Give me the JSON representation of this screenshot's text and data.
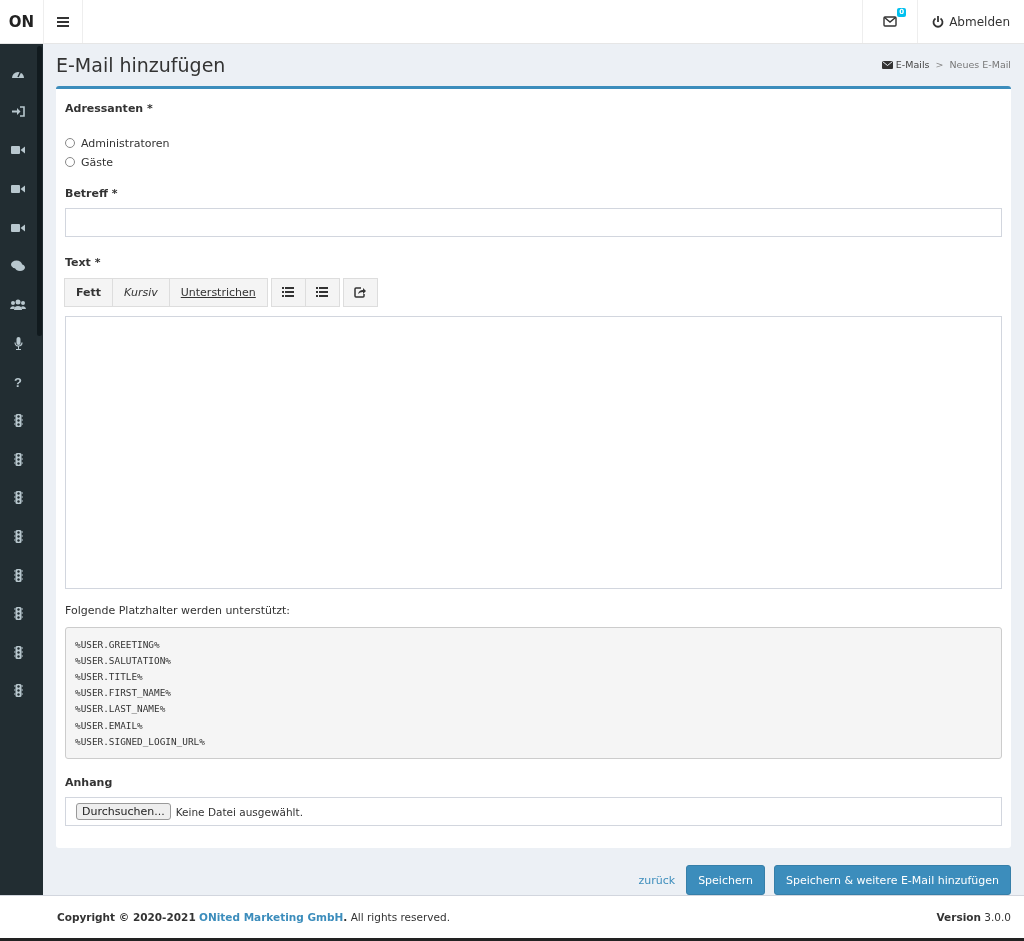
{
  "brand": "ON",
  "header": {
    "mail_badge": "0",
    "logout": "Abmelden"
  },
  "sidebar": {
    "items": [
      {
        "kind": "gauge"
      },
      {
        "kind": "login"
      },
      {
        "kind": "video"
      },
      {
        "kind": "video"
      },
      {
        "kind": "video"
      },
      {
        "kind": "chat"
      },
      {
        "kind": "users"
      },
      {
        "kind": "mic"
      },
      {
        "kind": "glyph",
        "text": "?"
      },
      {
        "kind": "traffic"
      },
      {
        "kind": "traffic"
      },
      {
        "kind": "traffic"
      },
      {
        "kind": "traffic"
      },
      {
        "kind": "traffic"
      },
      {
        "kind": "traffic"
      },
      {
        "kind": "traffic"
      },
      {
        "kind": "traffic"
      }
    ]
  },
  "page": {
    "title": "E-Mail hinzufügen",
    "breadcrumb_separator": ">",
    "breadcrumb": [
      {
        "label": "E-Mails",
        "kind": "link"
      },
      {
        "label": "Neues E-Mail",
        "kind": "current"
      }
    ]
  },
  "form": {
    "recipients": {
      "label": "Adressanten *",
      "options": [
        {
          "label": "Administratoren",
          "selected": false
        },
        {
          "label": "Gäste",
          "selected": false
        }
      ]
    },
    "subject": {
      "label": "Betreff *"
    },
    "text": {
      "label": "Text *",
      "toolbar": [
        [
          {
            "kind": "bold",
            "label": "Fett"
          },
          {
            "kind": "italic",
            "label": "Kursiv"
          },
          {
            "kind": "underline",
            "label": "Unterstrichen"
          }
        ],
        [
          {
            "kind": "list-icon"
          },
          {
            "kind": "list-icon"
          }
        ],
        [
          {
            "kind": "share-icon"
          }
        ]
      ]
    },
    "placeholders_caption": "Folgende Platzhalter werden unterstützt:",
    "placeholders": [
      "%USER.GREETING%",
      "%USER.SALUTATION%",
      "%USER.TITLE%",
      "%USER.FIRST_NAME%",
      "%USER.LAST_NAME%",
      "%USER.EMAIL%",
      "%USER.SIGNED_LOGIN_URL%"
    ],
    "attachment": {
      "label": "Anhang",
      "button": "Durchsuchen...",
      "status": "Keine Datei ausgewählt."
    }
  },
  "actions": {
    "back": "zurück",
    "save": "Speichern",
    "save_more": "Speichern & weitere E-Mail hinzufügen"
  },
  "footer": {
    "copyright_prefix": "Copyright © 2020-2021",
    "company": "ONited Marketing GmbH",
    "copyright_suffix": "**.** All rights reserved.",
    "version": "**Version** 3.0.0"
  }
}
